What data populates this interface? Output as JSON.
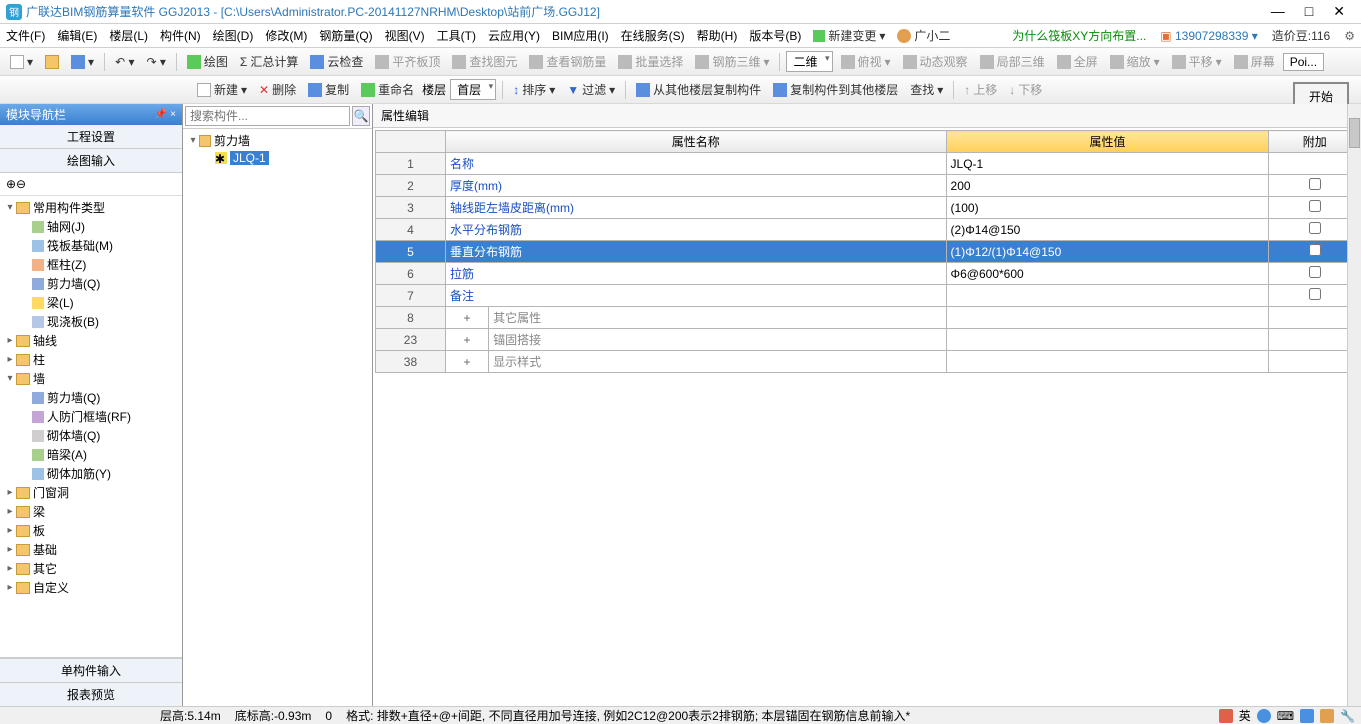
{
  "title": "广联达BIM钢筋算量软件 GGJ2013 - [C:\\Users\\Administrator.PC-20141127NRHM\\Desktop\\站前广场.GGJ12]",
  "menus": [
    "文件(F)",
    "编辑(E)",
    "楼层(L)",
    "构件(N)",
    "绘图(D)",
    "修改(M)",
    "钢筋量(Q)",
    "视图(V)",
    "工具(T)",
    "云应用(Y)",
    "BIM应用(I)",
    "在线服务(S)",
    "帮助(H)",
    "版本号(B)"
  ],
  "newchange": "新建变更",
  "gx_user": "广小二",
  "promo": "为什么筏板XY方向布置...",
  "phone": "13907298339",
  "credit_label": "造价豆:",
  "credit_val": "116",
  "tb1": {
    "draw": "绘图",
    "sumcalc": "汇总计算",
    "cloudchk": "云检查",
    "flatslab": "平齐板顶",
    "findgraph": "查找图元",
    "viewrebar": "查看钢筋量",
    "batchsel": "批量选择",
    "rebar3d": "钢筋三维",
    "view2d": "二维",
    "bird": "俯视",
    "dynview": "动态观察",
    "local3d": "局部三维",
    "full": "全屏",
    "zoom": "缩放",
    "pan": "平移",
    "screen": "屏幕",
    "poi": "Poi..."
  },
  "tb2": {
    "new": "新建",
    "del": "删除",
    "copy": "复制",
    "rename": "重命名",
    "floor": "楼层",
    "firstfloor": "首层",
    "sort": "排序",
    "filter": "过滤",
    "copyfrom": "从其他楼层复制构件",
    "copyto": "复制构件到其他楼层",
    "find": "查找",
    "up": "上移",
    "down": "下移"
  },
  "start": "开始",
  "nav": {
    "title": "模块导航栏",
    "item1": "工程设置",
    "item2": "绘图输入",
    "tab1": "单构件输入",
    "tab2": "报表预览"
  },
  "tree": {
    "common": "常用构件类型",
    "common_items": [
      "轴网(J)",
      "筏板基础(M)",
      "框柱(Z)",
      "剪力墙(Q)",
      "梁(L)",
      "现浇板(B)"
    ],
    "axis": "轴线",
    "column": "柱",
    "wall": "墙",
    "wall_items": [
      "剪力墙(Q)",
      "人防门框墙(RF)",
      "砌体墙(Q)",
      "暗梁(A)",
      "砌体加筋(Y)"
    ],
    "doorwin": "门窗洞",
    "beam": "梁",
    "slab": "板",
    "foundation": "基础",
    "other": "其它",
    "custom": "自定义"
  },
  "mid": {
    "search_ph": "搜索构件...",
    "root": "剪力墙",
    "node": "JLQ-1"
  },
  "prop": {
    "title": "属性编辑",
    "h_name": "属性名称",
    "h_val": "属性值",
    "h_ext": "附加",
    "rows": [
      {
        "n": "1",
        "name": "名称",
        "val": "JLQ-1",
        "chk": ""
      },
      {
        "n": "2",
        "name": "厚度(mm)",
        "val": "200",
        "chk": "0"
      },
      {
        "n": "3",
        "name": "轴线距左墙皮距离(mm)",
        "val": "(100)",
        "chk": "0"
      },
      {
        "n": "4",
        "name": "水平分布钢筋",
        "val": "(2)Φ14@150",
        "chk": "0"
      },
      {
        "n": "5",
        "name": "垂直分布钢筋",
        "val": "(1)Φ12/(1)Φ14@150",
        "chk": "0",
        "sel": true
      },
      {
        "n": "6",
        "name": "拉筋",
        "val": "Φ6@600*600",
        "chk": "0"
      },
      {
        "n": "7",
        "name": "备注",
        "val": "",
        "chk": "0"
      },
      {
        "n": "8",
        "name": "其它属性",
        "exp": "+",
        "gray": true
      },
      {
        "n": "23",
        "name": "锚固搭接",
        "exp": "+",
        "gray": true
      },
      {
        "n": "38",
        "name": "显示样式",
        "exp": "+",
        "gray": true
      }
    ]
  },
  "status": {
    "ch": "层高:5.14m",
    "dh": "底标高:-0.93m",
    "zero": "0",
    "hint": "格式: 排数+直径+@+间距, 不同直径用加号连接, 例如2C12@200表示2排钢筋; 本层锚固在钢筋信息前输入*",
    "ime": "英"
  }
}
